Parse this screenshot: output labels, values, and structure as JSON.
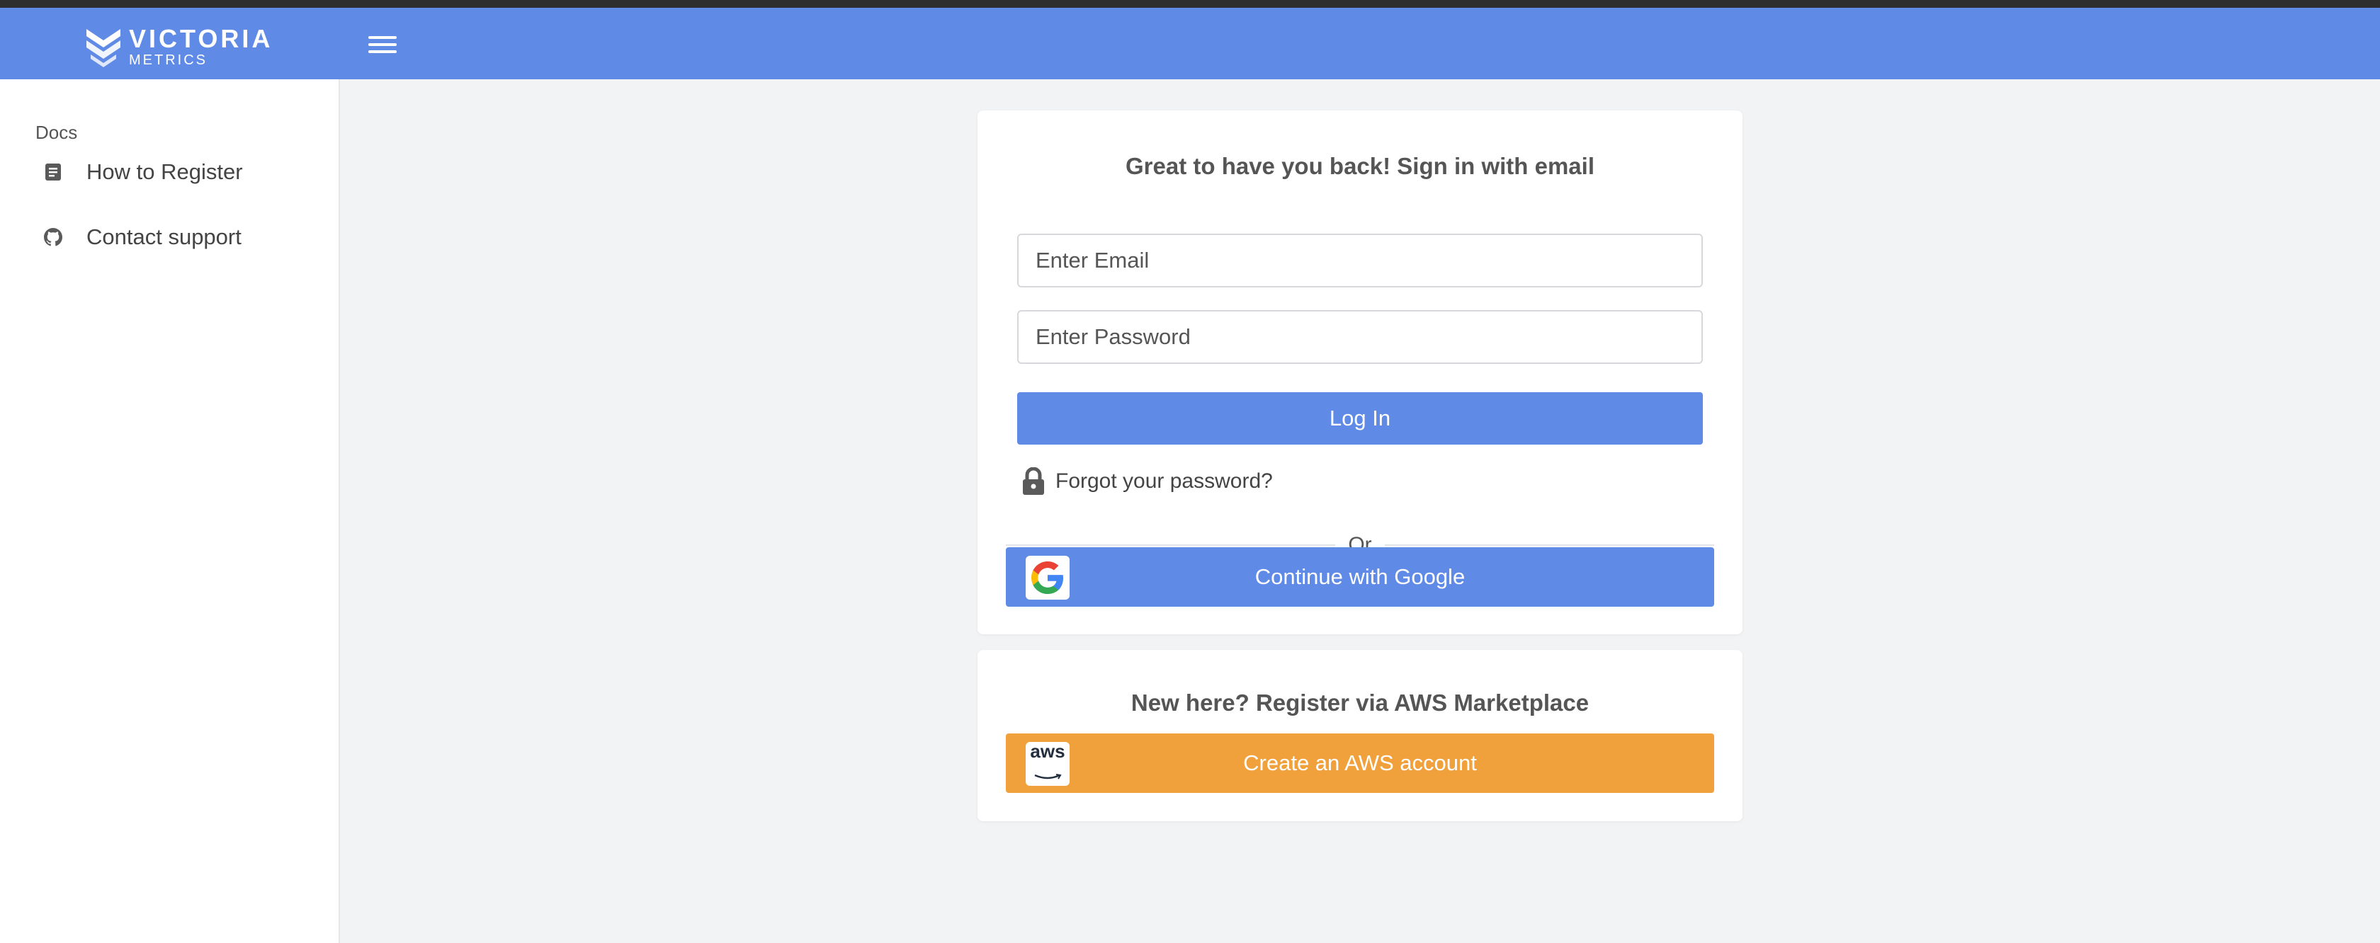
{
  "header": {
    "brand_line1": "VICTORIA",
    "brand_line2": "METRICS",
    "color": "#5f8ae6",
    "icons": {
      "logo": "victoria-metrics-logo-icon",
      "menu": "hamburger-menu-icon"
    }
  },
  "sidebar": {
    "section_title": "Docs",
    "items": [
      {
        "label": "How to Register",
        "icon": "document-icon"
      },
      {
        "label": "Contact support",
        "icon": "github-icon"
      }
    ]
  },
  "login": {
    "title": "Great to have you back! Sign in with email",
    "email_placeholder": "Enter Email",
    "password_placeholder": "Enter Password",
    "login_label": "Log In",
    "forgot_label": "Forgot your password?",
    "divider_label": "Or",
    "google_label": "Continue with Google"
  },
  "register": {
    "title": "New here? Register via AWS Marketplace",
    "aws_label": "Create an AWS account",
    "aws_logo_text": "aws"
  },
  "colors": {
    "primary": "#5f8ae6",
    "aws_orange": "#f0a13b",
    "background": "#f2f3f5"
  }
}
